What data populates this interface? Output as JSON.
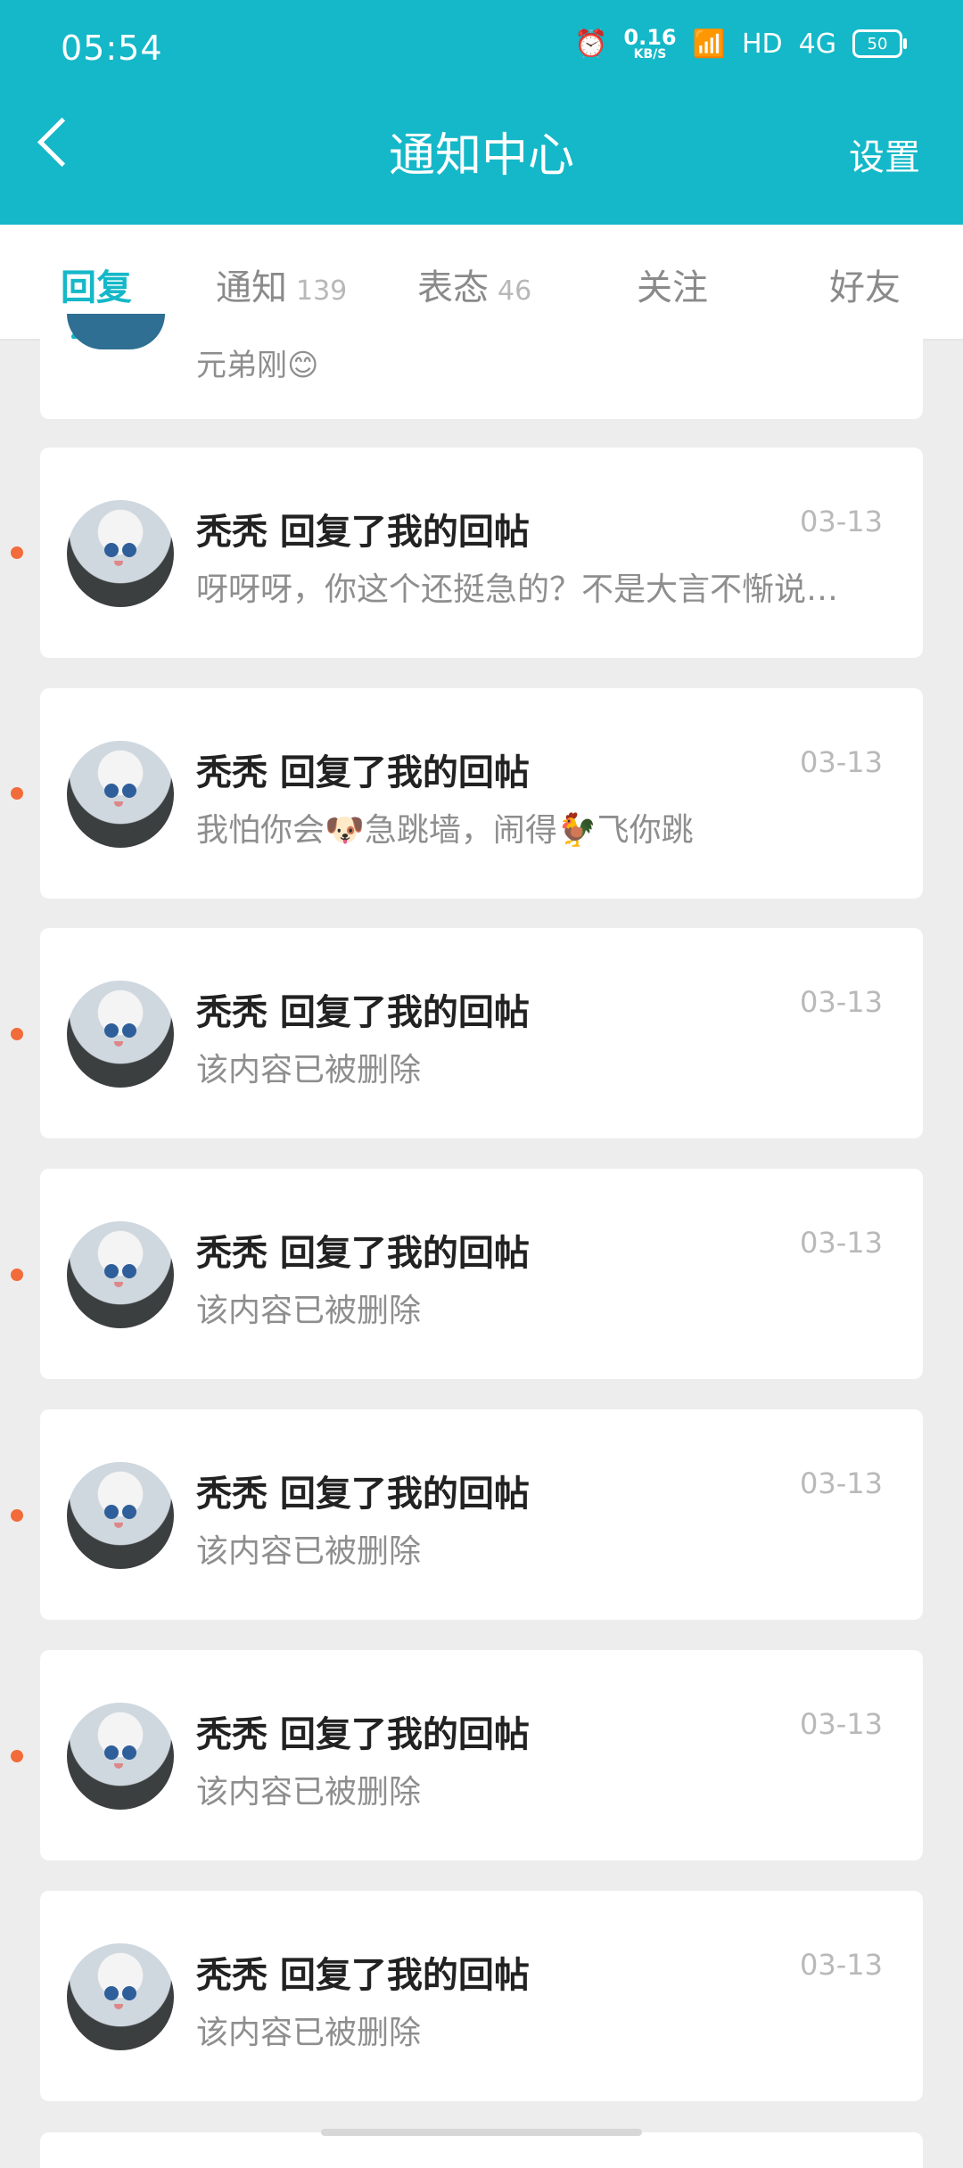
{
  "status_bar": {
    "time": "05:54",
    "speed_value": "0.16",
    "speed_unit": "KB/S",
    "hd": "HD",
    "network": "4G",
    "battery": "50"
  },
  "header": {
    "title": "通知中心",
    "settings": "设置"
  },
  "tabs": [
    {
      "label": "回复",
      "badge": ""
    },
    {
      "label": "通知",
      "badge": "139"
    },
    {
      "label": "表态",
      "badge": "46"
    },
    {
      "label": "关注",
      "badge": ""
    },
    {
      "label": "好友",
      "badge": ""
    }
  ],
  "partial_item": {
    "snippet": "元弟刚😊"
  },
  "items": [
    {
      "title": "秃秃 回复了我的回帖",
      "date": "03-13",
      "message": "呀呀呀，你这个还挺急的？不是大言不惭说…"
    },
    {
      "title": "秃秃 回复了我的回帖",
      "date": "03-13",
      "message": "我怕你会🐶急跳墙，闹得🐓飞你跳"
    },
    {
      "title": "秃秃 回复了我的回帖",
      "date": "03-13",
      "message": "该内容已被删除"
    },
    {
      "title": "秃秃 回复了我的回帖",
      "date": "03-13",
      "message": "该内容已被删除"
    },
    {
      "title": "秃秃 回复了我的回帖",
      "date": "03-13",
      "message": "该内容已被删除"
    },
    {
      "title": "秃秃 回复了我的回帖",
      "date": "03-13",
      "message": "该内容已被删除"
    },
    {
      "title": "秃秃 回复了我的回帖",
      "date": "03-13",
      "message": "该内容已被删除"
    }
  ],
  "colors": {
    "accent": "#14b8c8",
    "unread_dot": "#f26b3a",
    "background": "#ededed"
  }
}
